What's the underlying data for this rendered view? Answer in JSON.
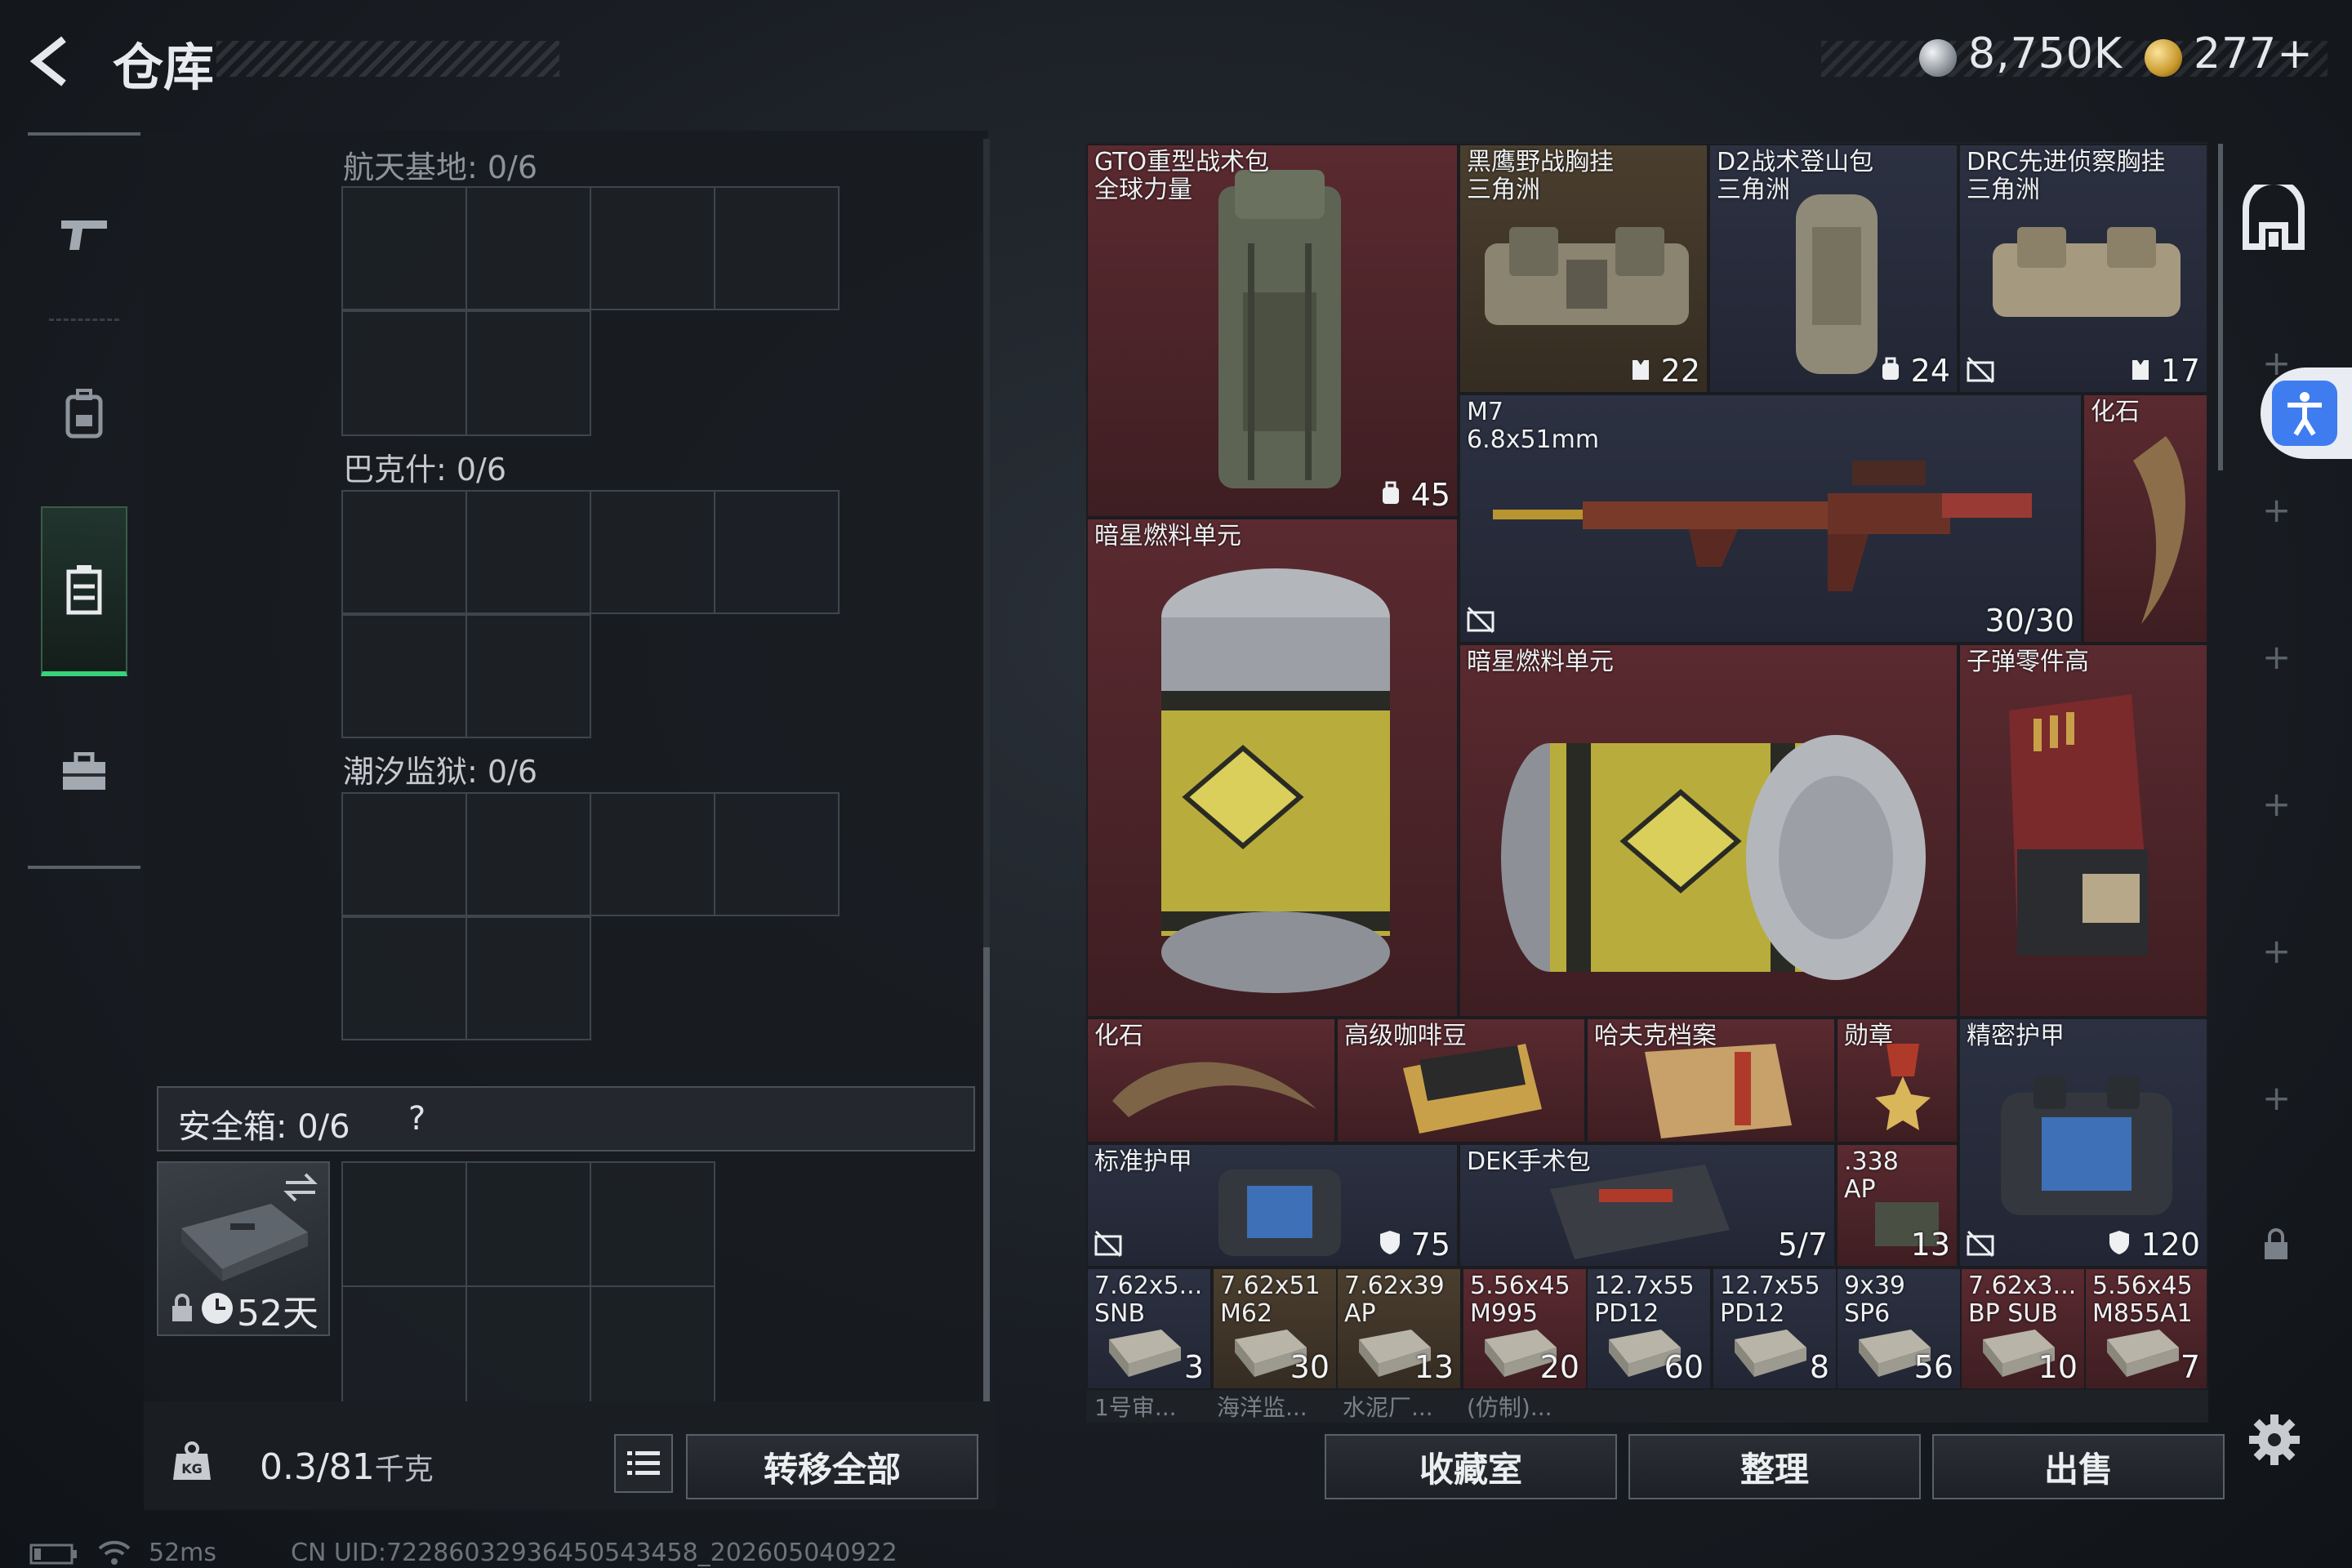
{
  "header": {
    "title": "仓库",
    "currency_silver": "8,750K",
    "currency_gold": "277+"
  },
  "left": {
    "sections": [
      {
        "label": "航天基地: 0/6"
      },
      {
        "label": "巴克什: 0/6"
      },
      {
        "label": "潮汐监狱: 0/6"
      }
    ],
    "safe_box": {
      "label": "安全箱:  0/6",
      "help": "?",
      "days": "52天"
    },
    "weight": {
      "value": "0.3/81",
      "unit": "千克"
    },
    "transfer_all": "转移全部"
  },
  "stash": {
    "items": [
      {
        "id": "gto",
        "name": "GTO重型战术包\n全球力量",
        "count": "45",
        "count_icon": "backpack"
      },
      {
        "id": "blackeagle",
        "name": "黑鹰野战胸挂\n三角洲",
        "count": "22",
        "count_icon": "vest"
      },
      {
        "id": "d2",
        "name": "D2战术登山包\n三角洲",
        "count": "24",
        "count_icon": "backpack"
      },
      {
        "id": "drc",
        "name": "DRC先进侦察胸挂\n三角洲",
        "count": "17",
        "count_icon": "vest"
      },
      {
        "id": "m7",
        "name": "M7\n6.8x51mm",
        "count": "30/30"
      },
      {
        "id": "fossil1",
        "name": "化石",
        "count": ""
      },
      {
        "id": "fuel1",
        "name": "暗星燃料单元",
        "count": ""
      },
      {
        "id": "fuel2",
        "name": "暗星燃料单元",
        "count": ""
      },
      {
        "id": "bullet_parts",
        "name": "子弹零件高",
        "count": ""
      },
      {
        "id": "fossil2",
        "name": "化石",
        "count": ""
      },
      {
        "id": "coffee",
        "name": "高级咖啡豆",
        "count": ""
      },
      {
        "id": "hafk",
        "name": "哈夫克档案",
        "count": ""
      },
      {
        "id": "medal",
        "name": "勋章",
        "count": ""
      },
      {
        "id": "precision",
        "name": "精密护甲",
        "count": "120",
        "count_icon": "shield"
      },
      {
        "id": "std_armor",
        "name": "标准护甲",
        "count": "75",
        "count_icon": "shield"
      },
      {
        "id": "dek",
        "name": "DEK手术包",
        "count": "5/7"
      },
      {
        "id": "ap338",
        "name": ".338\nAP",
        "count": "13"
      }
    ],
    "ammo": [
      {
        "name": "7.62x5...\nSNB",
        "count": "3"
      },
      {
        "name": "7.62x51\nM62",
        "count": "30"
      },
      {
        "name": "7.62x39\nAP",
        "count": "13"
      },
      {
        "name": "5.56x45\nM995",
        "count": "20"
      },
      {
        "name": "12.7x55\nPD12",
        "count": "60"
      },
      {
        "name": "12.7x55\nPD12",
        "count": "8"
      },
      {
        "name": "9x39\nSP6",
        "count": "56"
      },
      {
        "name": "7.62x3...\nBP SUB",
        "count": "10"
      },
      {
        "name": "5.56x45\nM855A1",
        "count": "7"
      }
    ],
    "partial_row": [
      "1号审...",
      "海洋监...",
      "水泥厂...",
      "(仿制)..."
    ]
  },
  "buttons": {
    "collection": "收藏室",
    "organize": "整理",
    "sell": "出售"
  },
  "status": {
    "ping": "52ms",
    "uid": "CN UID:72286032936450543458_202605040922"
  },
  "colors": {
    "accent_green": "#38d27a",
    "cell_red": "#5a2a30",
    "cell_blue": "#2c3142",
    "access_blue": "#3e7cf0"
  }
}
